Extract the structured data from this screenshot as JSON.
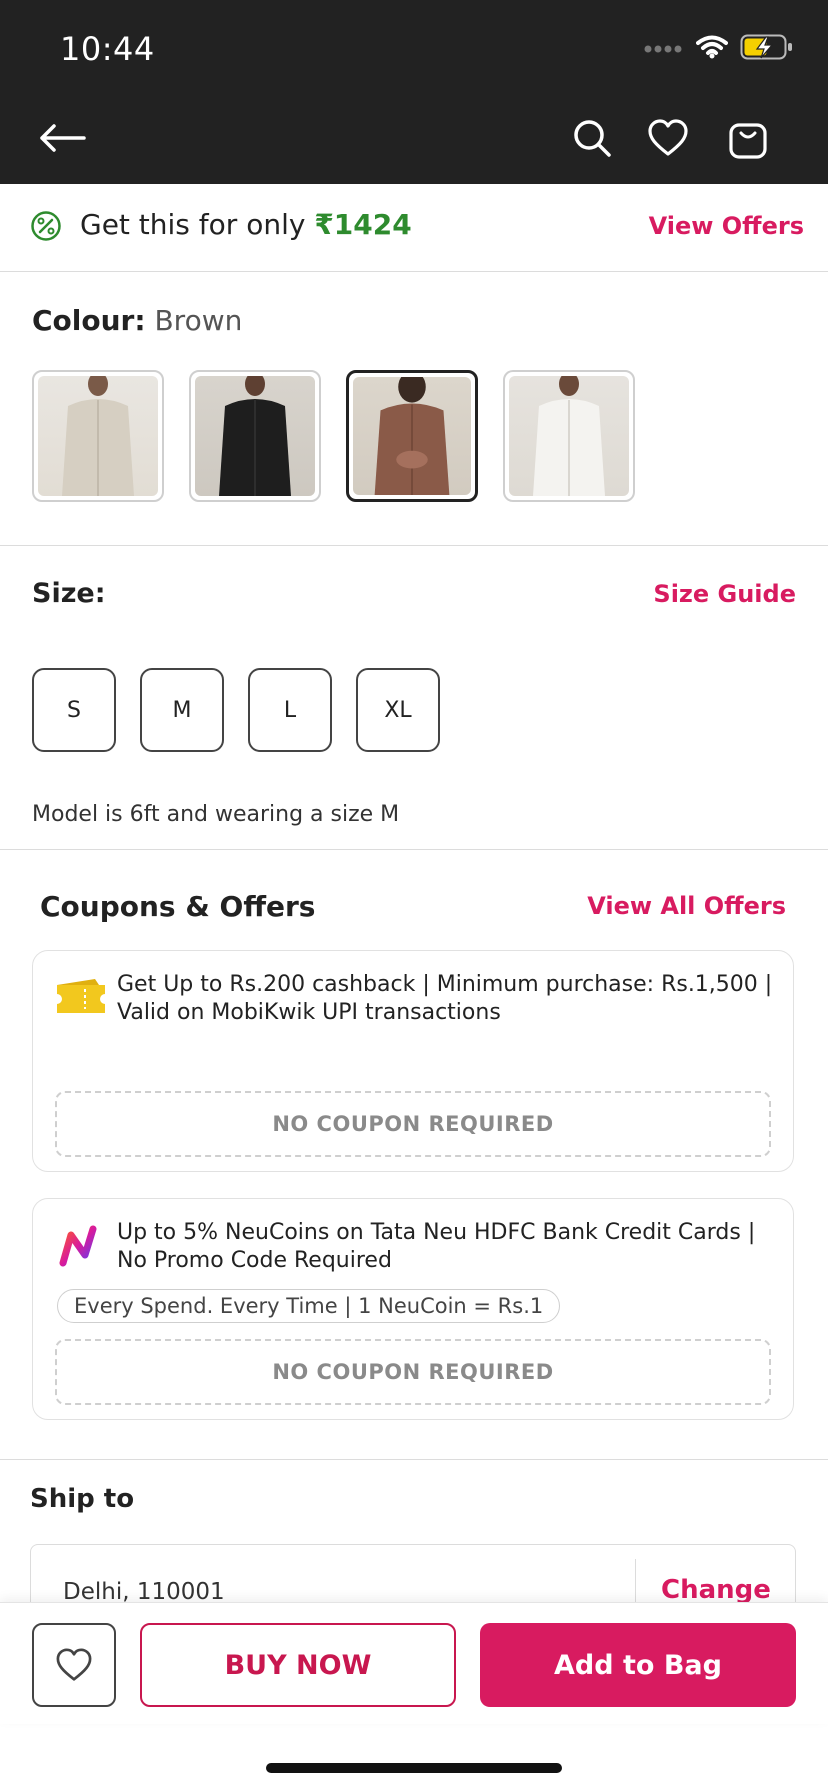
{
  "status_bar": {
    "time": "10:44"
  },
  "header": {
    "icons": [
      "back-arrow-icon",
      "search-icon",
      "heart-icon",
      "shopping-bag-icon"
    ]
  },
  "offer_strip": {
    "prefix": "Get this for only ",
    "price": "₹1424",
    "link": "View Offers"
  },
  "colour": {
    "label": "Colour:",
    "value": "Brown",
    "swatches": [
      {
        "name": "Off-white",
        "color": "#d9d2c5"
      },
      {
        "name": "Black",
        "color": "#1e1e1e"
      },
      {
        "name": "Brown",
        "color": "#8a5a48",
        "selected": true
      },
      {
        "name": "White",
        "color": "#ececea"
      }
    ]
  },
  "size": {
    "label": "Size:",
    "guide_link": "Size Guide",
    "options": [
      "S",
      "M",
      "L",
      "XL"
    ],
    "model_note": "Model is 6ft and wearing a size M"
  },
  "coupons": {
    "title": "Coupons & Offers",
    "view_all": "View All Offers",
    "items": [
      {
        "icon": "ticket-icon",
        "text": "Get Up to Rs.200 cashback | Minimum purchase: Rs.1,500 | Valid on MobiKwik UPI transactions",
        "code": "NO COUPON REQUIRED"
      },
      {
        "icon": "neu-logo-icon",
        "text": "Up to 5% NeuCoins on Tata Neu HDFC Bank Credit Cards | No Promo Code Required",
        "pill": "Every Spend. Every Time | 1 NeuCoin = Rs.1",
        "code": "NO COUPON REQUIRED"
      }
    ]
  },
  "ship": {
    "title": "Ship to",
    "address": "Delhi, 110001",
    "change": "Change"
  },
  "bottom_bar": {
    "buy_now": "BUY NOW",
    "add_to_bag": "Add to Bag"
  },
  "colors": {
    "accent": "#d81b60",
    "price_green": "#2e8b2e",
    "header_bg": "#222222"
  }
}
